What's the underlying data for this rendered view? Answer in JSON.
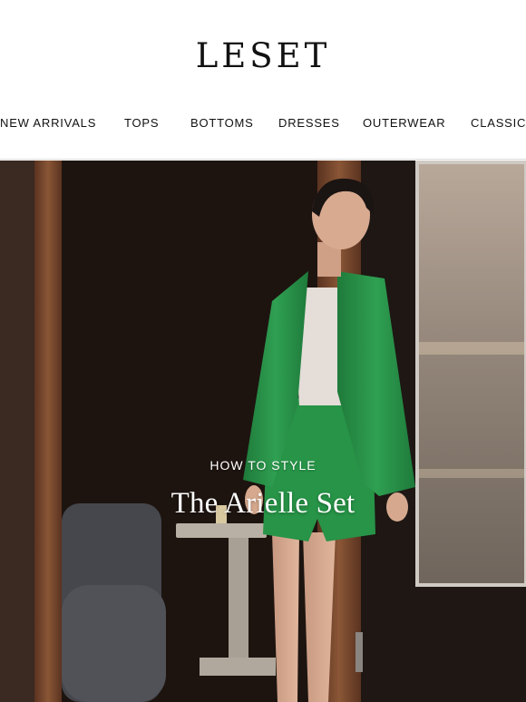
{
  "brand": {
    "logo_text": "LESET"
  },
  "nav": {
    "items": [
      {
        "label": "NEW ARRIVALS"
      },
      {
        "label": "TOPS"
      },
      {
        "label": "BOTTOMS"
      },
      {
        "label": "DRESSES"
      },
      {
        "label": "OUTERWEAR"
      },
      {
        "label": "CLASSICS"
      }
    ]
  },
  "hero": {
    "eyebrow": "HOW TO STYLE",
    "headline": "The Arielle Set",
    "image_description_icon": "model-photo",
    "colors": {
      "jacket": "#2a9a4a",
      "background": "#2a1d17",
      "wood": "#7a4a30"
    }
  }
}
